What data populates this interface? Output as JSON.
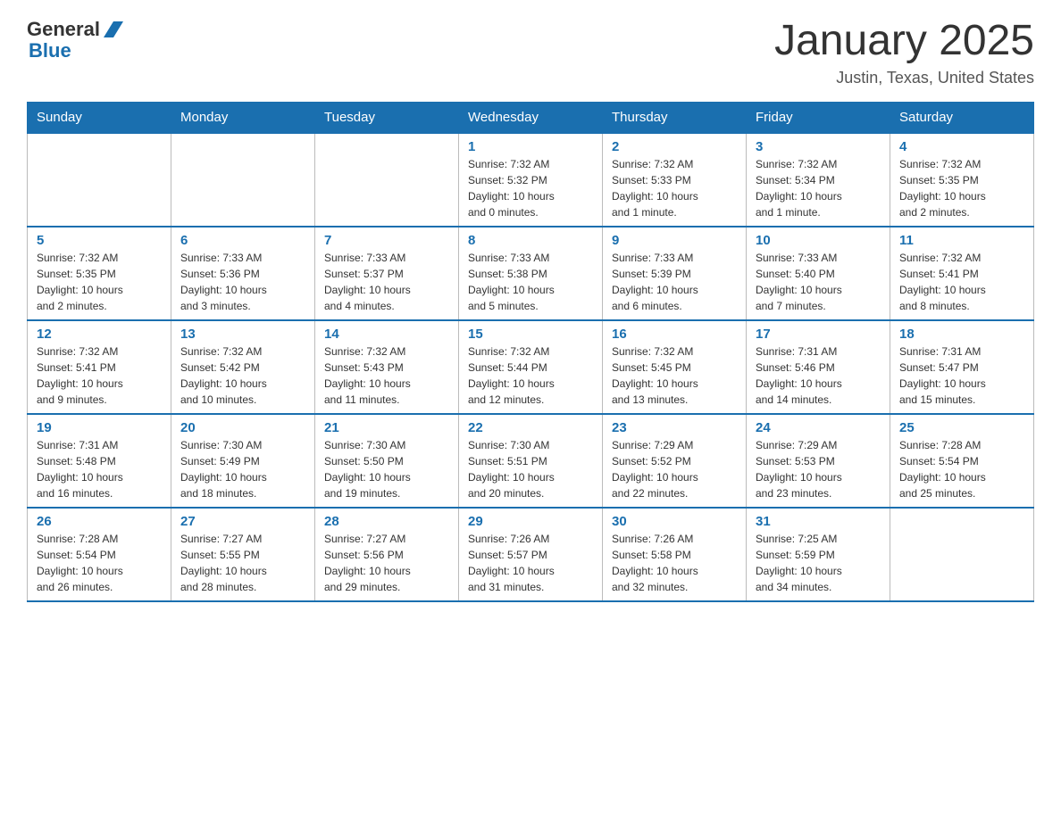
{
  "header": {
    "logo_general": "General",
    "logo_blue": "Blue",
    "month_title": "January 2025",
    "location": "Justin, Texas, United States"
  },
  "days_of_week": [
    "Sunday",
    "Monday",
    "Tuesday",
    "Wednesday",
    "Thursday",
    "Friday",
    "Saturday"
  ],
  "weeks": [
    [
      {
        "day": "",
        "info": ""
      },
      {
        "day": "",
        "info": ""
      },
      {
        "day": "",
        "info": ""
      },
      {
        "day": "1",
        "info": "Sunrise: 7:32 AM\nSunset: 5:32 PM\nDaylight: 10 hours\nand 0 minutes."
      },
      {
        "day": "2",
        "info": "Sunrise: 7:32 AM\nSunset: 5:33 PM\nDaylight: 10 hours\nand 1 minute."
      },
      {
        "day": "3",
        "info": "Sunrise: 7:32 AM\nSunset: 5:34 PM\nDaylight: 10 hours\nand 1 minute."
      },
      {
        "day": "4",
        "info": "Sunrise: 7:32 AM\nSunset: 5:35 PM\nDaylight: 10 hours\nand 2 minutes."
      }
    ],
    [
      {
        "day": "5",
        "info": "Sunrise: 7:32 AM\nSunset: 5:35 PM\nDaylight: 10 hours\nand 2 minutes."
      },
      {
        "day": "6",
        "info": "Sunrise: 7:33 AM\nSunset: 5:36 PM\nDaylight: 10 hours\nand 3 minutes."
      },
      {
        "day": "7",
        "info": "Sunrise: 7:33 AM\nSunset: 5:37 PM\nDaylight: 10 hours\nand 4 minutes."
      },
      {
        "day": "8",
        "info": "Sunrise: 7:33 AM\nSunset: 5:38 PM\nDaylight: 10 hours\nand 5 minutes."
      },
      {
        "day": "9",
        "info": "Sunrise: 7:33 AM\nSunset: 5:39 PM\nDaylight: 10 hours\nand 6 minutes."
      },
      {
        "day": "10",
        "info": "Sunrise: 7:33 AM\nSunset: 5:40 PM\nDaylight: 10 hours\nand 7 minutes."
      },
      {
        "day": "11",
        "info": "Sunrise: 7:32 AM\nSunset: 5:41 PM\nDaylight: 10 hours\nand 8 minutes."
      }
    ],
    [
      {
        "day": "12",
        "info": "Sunrise: 7:32 AM\nSunset: 5:41 PM\nDaylight: 10 hours\nand 9 minutes."
      },
      {
        "day": "13",
        "info": "Sunrise: 7:32 AM\nSunset: 5:42 PM\nDaylight: 10 hours\nand 10 minutes."
      },
      {
        "day": "14",
        "info": "Sunrise: 7:32 AM\nSunset: 5:43 PM\nDaylight: 10 hours\nand 11 minutes."
      },
      {
        "day": "15",
        "info": "Sunrise: 7:32 AM\nSunset: 5:44 PM\nDaylight: 10 hours\nand 12 minutes."
      },
      {
        "day": "16",
        "info": "Sunrise: 7:32 AM\nSunset: 5:45 PM\nDaylight: 10 hours\nand 13 minutes."
      },
      {
        "day": "17",
        "info": "Sunrise: 7:31 AM\nSunset: 5:46 PM\nDaylight: 10 hours\nand 14 minutes."
      },
      {
        "day": "18",
        "info": "Sunrise: 7:31 AM\nSunset: 5:47 PM\nDaylight: 10 hours\nand 15 minutes."
      }
    ],
    [
      {
        "day": "19",
        "info": "Sunrise: 7:31 AM\nSunset: 5:48 PM\nDaylight: 10 hours\nand 16 minutes."
      },
      {
        "day": "20",
        "info": "Sunrise: 7:30 AM\nSunset: 5:49 PM\nDaylight: 10 hours\nand 18 minutes."
      },
      {
        "day": "21",
        "info": "Sunrise: 7:30 AM\nSunset: 5:50 PM\nDaylight: 10 hours\nand 19 minutes."
      },
      {
        "day": "22",
        "info": "Sunrise: 7:30 AM\nSunset: 5:51 PM\nDaylight: 10 hours\nand 20 minutes."
      },
      {
        "day": "23",
        "info": "Sunrise: 7:29 AM\nSunset: 5:52 PM\nDaylight: 10 hours\nand 22 minutes."
      },
      {
        "day": "24",
        "info": "Sunrise: 7:29 AM\nSunset: 5:53 PM\nDaylight: 10 hours\nand 23 minutes."
      },
      {
        "day": "25",
        "info": "Sunrise: 7:28 AM\nSunset: 5:54 PM\nDaylight: 10 hours\nand 25 minutes."
      }
    ],
    [
      {
        "day": "26",
        "info": "Sunrise: 7:28 AM\nSunset: 5:54 PM\nDaylight: 10 hours\nand 26 minutes."
      },
      {
        "day": "27",
        "info": "Sunrise: 7:27 AM\nSunset: 5:55 PM\nDaylight: 10 hours\nand 28 minutes."
      },
      {
        "day": "28",
        "info": "Sunrise: 7:27 AM\nSunset: 5:56 PM\nDaylight: 10 hours\nand 29 minutes."
      },
      {
        "day": "29",
        "info": "Sunrise: 7:26 AM\nSunset: 5:57 PM\nDaylight: 10 hours\nand 31 minutes."
      },
      {
        "day": "30",
        "info": "Sunrise: 7:26 AM\nSunset: 5:58 PM\nDaylight: 10 hours\nand 32 minutes."
      },
      {
        "day": "31",
        "info": "Sunrise: 7:25 AM\nSunset: 5:59 PM\nDaylight: 10 hours\nand 34 minutes."
      },
      {
        "day": "",
        "info": ""
      }
    ]
  ]
}
